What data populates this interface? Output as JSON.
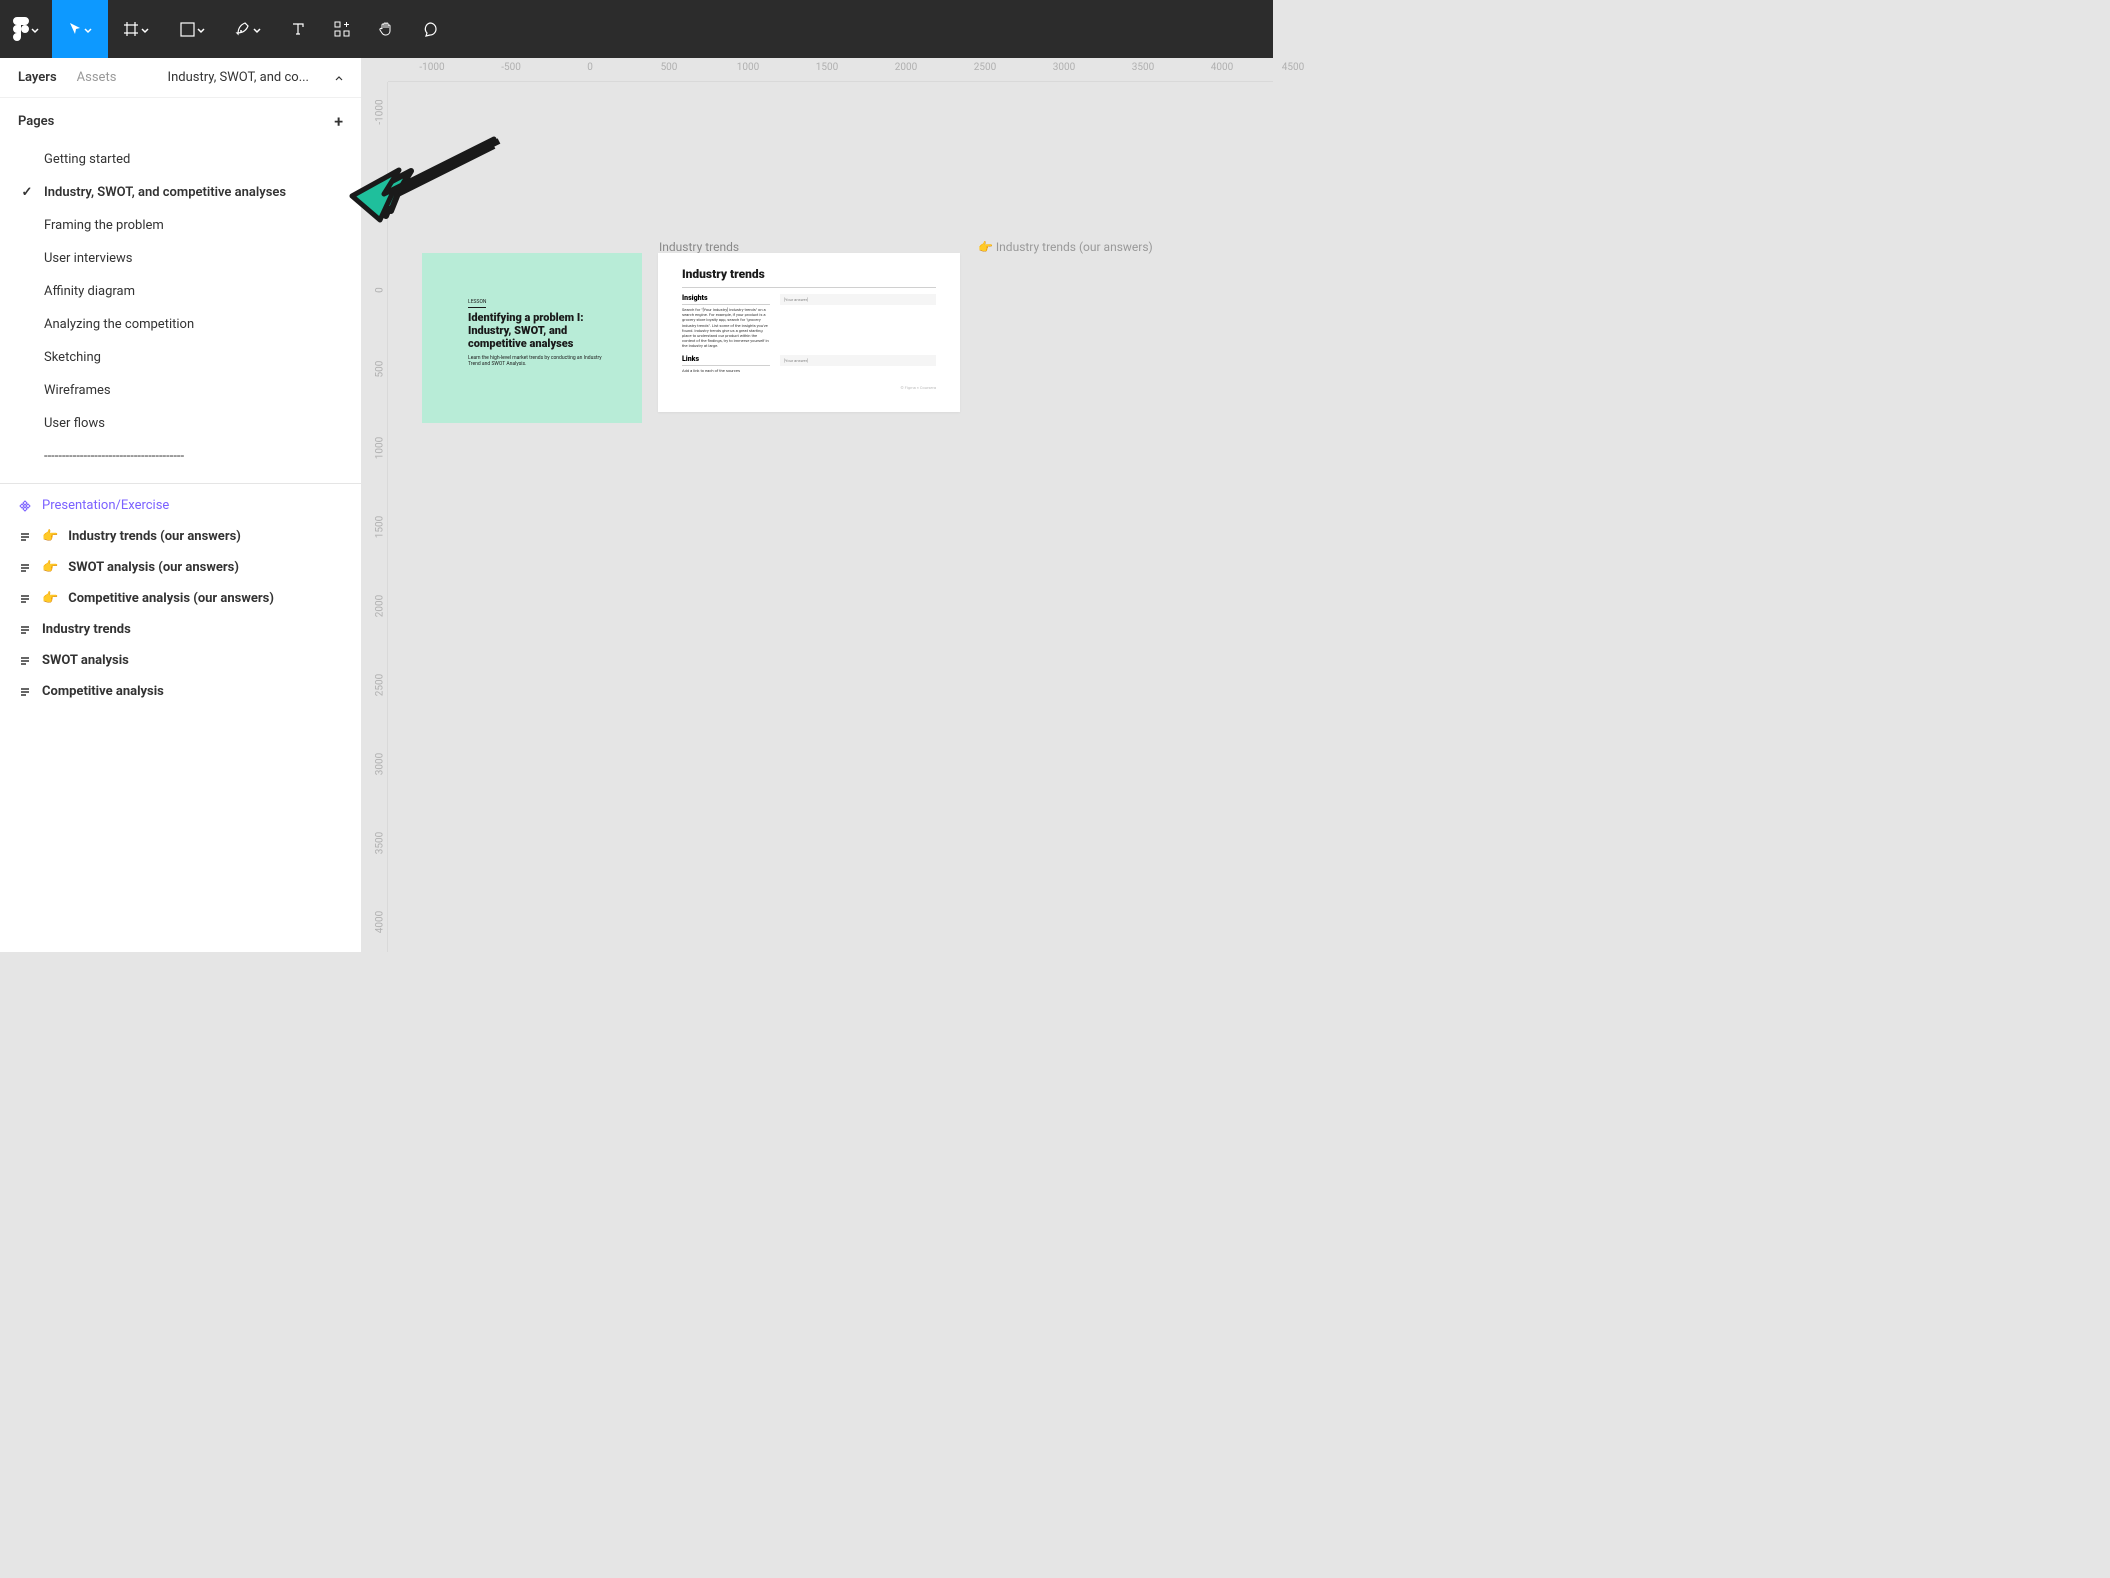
{
  "toolbar": {
    "tools": [
      "logo",
      "move",
      "frame",
      "rectangle",
      "pen",
      "text",
      "resources",
      "hand",
      "comment"
    ]
  },
  "leftPanel": {
    "tabs": {
      "layers": "Layers",
      "assets": "Assets"
    },
    "currentPage": "Industry, SWOT, and co...",
    "pagesHeader": "Pages",
    "pages": [
      {
        "label": "Getting started",
        "active": false
      },
      {
        "label": "Industry, SWOT, and competitive analyses",
        "active": true
      },
      {
        "label": "Framing the problem",
        "active": false
      },
      {
        "label": "User interviews",
        "active": false
      },
      {
        "label": "Affinity diagram",
        "active": false
      },
      {
        "label": "Analyzing the competition",
        "active": false
      },
      {
        "label": "Sketching",
        "active": false
      },
      {
        "label": "Wireframes",
        "active": false
      },
      {
        "label": "User flows",
        "active": false
      },
      {
        "label": "---------------------------------------",
        "active": false,
        "sep": true
      }
    ],
    "layers": [
      {
        "type": "component",
        "label": "Presentation/Exercise"
      },
      {
        "type": "frame",
        "emoji": "👉",
        "label": "Industry trends (our answers)",
        "bold": true
      },
      {
        "type": "frame",
        "emoji": "👉",
        "label": "SWOT analysis (our answers)",
        "bold": true
      },
      {
        "type": "frame",
        "emoji": "👉",
        "label": "Competitive analysis (our answers)",
        "bold": true
      },
      {
        "type": "frame",
        "label": "Industry trends",
        "bold": true
      },
      {
        "type": "frame",
        "label": "SWOT analysis",
        "bold": true
      },
      {
        "type": "frame",
        "label": "Competitive analysis",
        "bold": true
      }
    ]
  },
  "ruler": {
    "h": [
      "-1000",
      "-500",
      "0",
      "500",
      "1000",
      "1500",
      "2000",
      "2500",
      "3000",
      "3500",
      "4000",
      "4500"
    ],
    "v": [
      "-1000",
      "0",
      "500",
      "1000",
      "1500",
      "2000",
      "2500",
      "3000",
      "3500",
      "4000"
    ]
  },
  "canvas": {
    "frameLabels": {
      "industryTrends": "Industry trends",
      "industryTrendsAnswers": "👉 Industry trends (our answers)"
    },
    "slide1": {
      "lesson": "LESSON",
      "title": "Identifying a problem I: Industry, SWOT, and competitive analyses",
      "subtitle": "Learn the high-level market trends by conducting an Industry Trend and SWOT Analysis."
    },
    "slide2": {
      "title": "Industry trends",
      "insights": "Insights",
      "insightsText": "Search for \"[Your Industry] industry trends\" on a search engine. For example, if your product is a grocery store loyalty app, search for \"grocery industry trends\". List some of the insights you've found. Industry trends give us a great starting place to understand our product within the context of the findings, try to immerse yourself in the industry at large.",
      "links": "Links",
      "linksText": "Add a link to each of the sources",
      "answerPlaceholder": "[Your answer]",
      "footer": "© Figma × Coursera"
    }
  }
}
